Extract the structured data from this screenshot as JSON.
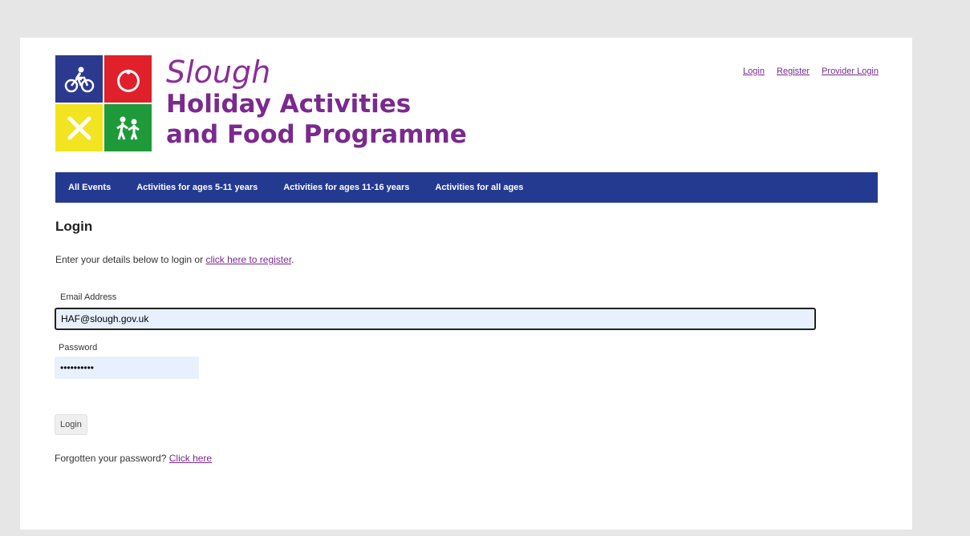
{
  "logo": {
    "line1": "Slough",
    "line2": "Holiday Activities",
    "line3": "and Food Programme",
    "tiles": [
      {
        "icon": "cyclist-icon",
        "color": "#2b3a8f"
      },
      {
        "icon": "tomato-icon",
        "color": "#e0202a"
      },
      {
        "icon": "cutlery-icon",
        "color": "#f2e420"
      },
      {
        "icon": "people-icon",
        "color": "#1f9a3a"
      }
    ]
  },
  "toplinks": {
    "login": "Login",
    "register": "Register",
    "provider_login": "Provider Login"
  },
  "nav": {
    "all_events": "All Events",
    "ages_5_11": "Activities for ages 5-11 years",
    "ages_11_16": "Activities for ages 11-16 years",
    "all_ages": "Activities for all ages",
    "color": "#243a91"
  },
  "main": {
    "title": "Login",
    "intro_text": "Enter your details below to login or ",
    "intro_link": "click here to register",
    "intro_end": ".",
    "email_label": "Email Address",
    "email_value": "HAF@slough.gov.uk",
    "password_label": "Password",
    "password_value": "••••••••••",
    "login_button": "Login",
    "forgot_text": "Forgotten your password? ",
    "forgot_link": "Click here"
  },
  "colors": {
    "accent_purple": "#7a2a8e",
    "nav_blue": "#243a91"
  }
}
